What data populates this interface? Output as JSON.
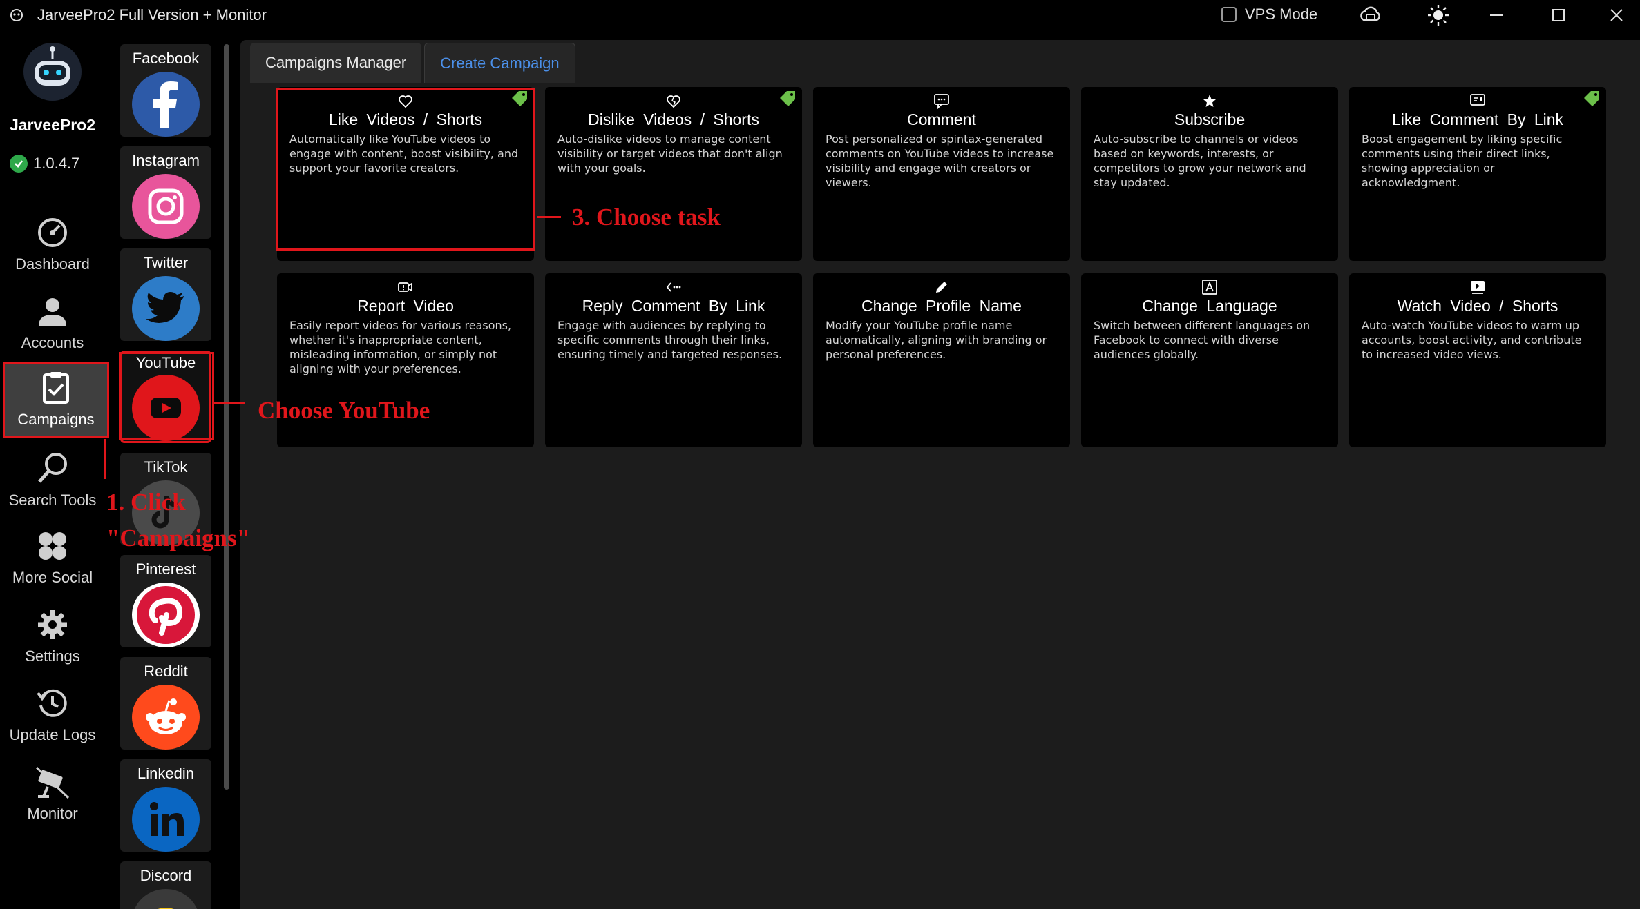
{
  "window": {
    "title": "JarveePro2 Full Version + Monitor",
    "vps_label": "VPS Mode",
    "vps_checked": false
  },
  "brand": {
    "name": "JarveePro2",
    "version": "1.0.4.7"
  },
  "nav": [
    {
      "id": "dashboard",
      "label": "Dashboard",
      "icon": "gauge-icon"
    },
    {
      "id": "accounts",
      "label": "Accounts",
      "icon": "user-icon"
    },
    {
      "id": "campaigns",
      "label": "Campaigns",
      "icon": "clipboard-check-icon",
      "active": true
    },
    {
      "id": "search-tools",
      "label": "Search Tools",
      "icon": "search-icon"
    },
    {
      "id": "more-social",
      "label": "More Social",
      "icon": "grid-icon"
    },
    {
      "id": "settings",
      "label": "Settings",
      "icon": "gear-icon"
    },
    {
      "id": "update-logs",
      "label": "Update Logs",
      "icon": "history-icon"
    },
    {
      "id": "monitor",
      "label": "Monitor",
      "icon": "camera-icon"
    }
  ],
  "social": [
    {
      "label": "Facebook",
      "color": "#2d5aa8"
    },
    {
      "label": "Instagram",
      "color": "#e8559b"
    },
    {
      "label": "Twitter",
      "color": "#2d7cc8"
    },
    {
      "label": "YouTube",
      "color": "#e0161b",
      "active": true
    },
    {
      "label": "TikTok",
      "color": "#4a4a4a"
    },
    {
      "label": "Pinterest",
      "color": "#d8173a"
    },
    {
      "label": "Reddit",
      "color": "#ff4a1c"
    },
    {
      "label": "Linkedin",
      "color": "#0a66c2"
    },
    {
      "label": "Discord",
      "color": "#f5c518"
    }
  ],
  "tabs": [
    {
      "label": "Campaigns Manager",
      "active": false
    },
    {
      "label": "Create Campaign",
      "active": true
    }
  ],
  "cards": [
    {
      "title": "Like  Videos  /  Shorts",
      "desc": "Automatically like YouTube videos to engage with content, boost visibility, and support your favorite creators.",
      "icon": "heart-icon",
      "tag": true
    },
    {
      "title": "Dislike  Videos  /  Shorts",
      "desc": "Auto-dislike videos to manage content visibility or target videos that don't align with your goals.",
      "icon": "broken-heart-icon",
      "tag": true
    },
    {
      "title": "Comment",
      "desc": "Post personalized or spintax-generated comments on YouTube videos to increase visibility and engage with creators or viewers.",
      "icon": "comment-icon",
      "tag": false
    },
    {
      "title": "Subscribe",
      "desc": "Auto-subscribe to channels or videos based on keywords, interests, or competitors to grow your network and stay updated.",
      "icon": "star-icon",
      "tag": false
    },
    {
      "title": "Like  Comment  By  Link",
      "desc": "Boost engagement by liking specific comments using their direct links, showing appreciation or acknowledgment.",
      "icon": "comment-like-icon",
      "tag": true
    },
    {
      "title": "Report  Video",
      "desc": "Easily report videos for various reasons, whether it's inappropriate content, misleading information, or simply not aligning with your preferences.",
      "icon": "report-video-icon",
      "tag": false
    },
    {
      "title": "Reply  Comment  By  Link",
      "desc": "Engage with audiences by replying to specific comments through their links, ensuring timely and targeted responses.",
      "icon": "reply-icon",
      "tag": false
    },
    {
      "title": "Change  Profile  Name",
      "desc": "Modify your YouTube profile name automatically, aligning with branding or personal preferences.",
      "icon": "pencil-icon",
      "tag": false
    },
    {
      "title": "Change  Language",
      "desc": "Switch between different languages on Facebook to connect with diverse audiences globally.",
      "icon": "language-icon",
      "tag": false
    },
    {
      "title": "Watch  Video /  Shorts",
      "desc": "Auto-watch YouTube videos to warm up accounts, boost activity, and contribute to increased video views.",
      "icon": "play-video-icon",
      "tag": false
    }
  ],
  "annotations": {
    "step1": "1. Click \"Campaigns\"",
    "step1_line1": "1. Click",
    "step1_line2": "\"Campaigns\"",
    "step2": "Choose YouTube",
    "step3": "3. Choose task"
  },
  "colors": {
    "accent_red": "#e0161b",
    "tab_active": "#4b8fe8",
    "ok_green": "#2ea84a"
  }
}
